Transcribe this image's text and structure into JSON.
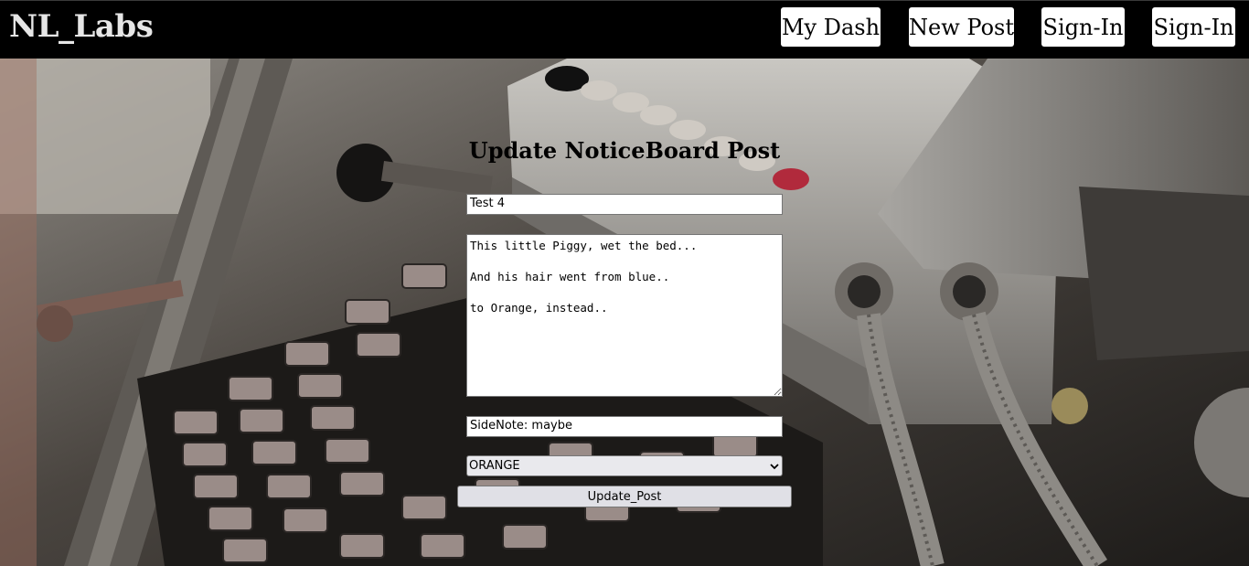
{
  "navbar": {
    "brand": "NL_Labs",
    "links": [
      "My Dash",
      "New Post",
      "Sign-In",
      "Sign-In"
    ]
  },
  "form": {
    "heading": "Update NoticeBoard Post",
    "title_value": "Test 4",
    "body_value": "This little Piggy, wet the bed...\n\nAnd his hair went from blue..\n\nto Orange, instead..",
    "sidenote_value": "SideNote: maybe",
    "color_selected": "ORANGE",
    "submit_label": "Update_Post"
  },
  "background": {
    "subject": "typewriter-photo"
  }
}
